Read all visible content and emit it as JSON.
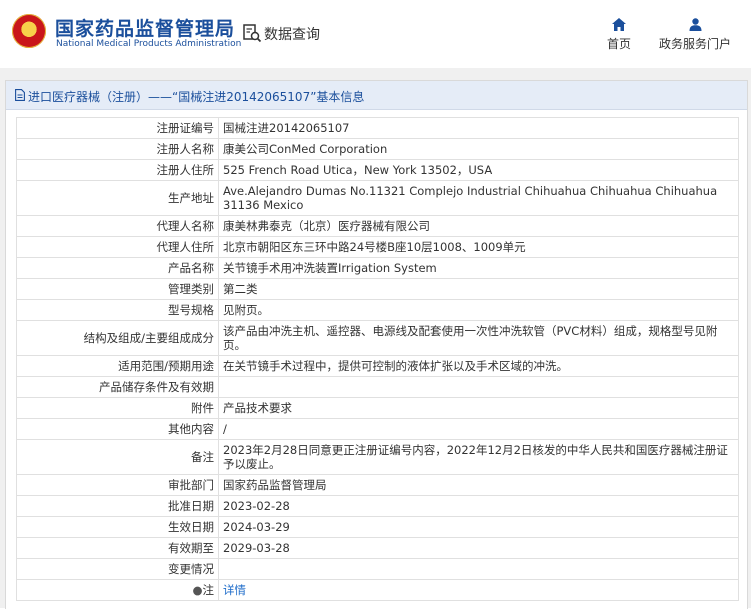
{
  "header": {
    "org_name_cn": "国家药品监督管理局",
    "org_name_en": "National Medical Products Administration",
    "search_label": "数据查询",
    "nav": [
      {
        "label": "首页",
        "icon": "home-icon"
      },
      {
        "label": "政务服务门户",
        "icon": "user-icon"
      }
    ]
  },
  "panel": {
    "title": "进口医疗器械（注册）——“国械注进20142065107”基本信息"
  },
  "records": [
    {
      "label": "注册证编号",
      "value": "国械注进20142065107"
    },
    {
      "label": "注册人名称",
      "value": "康美公司ConMed Corporation"
    },
    {
      "label": "注册人住所",
      "value": "525 French Road Utica，New York 13502，USA"
    },
    {
      "label": "生产地址",
      "value": "Ave.Alejandro Dumas No.11321 Complejo Industrial Chihuahua Chihuahua Chihuahua 31136 Mexico"
    },
    {
      "label": "代理人名称",
      "value": "康美林弗泰克（北京）医疗器械有限公司"
    },
    {
      "label": "代理人住所",
      "value": "北京市朝阳区东三环中路24号楼B座10层1008、1009单元"
    },
    {
      "label": "产品名称",
      "value": "关节镜手术用冲洗装置Irrigation System"
    },
    {
      "label": "管理类别",
      "value": "第二类"
    },
    {
      "label": "型号规格",
      "value": "见附页。"
    },
    {
      "label": "结构及组成/主要组成成分",
      "value": "该产品由冲洗主机、遥控器、电源线及配套使用一次性冲洗软管（PVC材料）组成，规格型号见附页。"
    },
    {
      "label": "适用范围/预期用途",
      "value": "在关节镜手术过程中，提供可控制的液体扩张以及手术区域的冲洗。"
    },
    {
      "label": "产品储存条件及有效期",
      "value": ""
    },
    {
      "label": "附件",
      "value": "产品技术要求"
    },
    {
      "label": "其他内容",
      "value": "/"
    },
    {
      "label": "备注",
      "value": "2023年2月28日同意更正注册证编号内容，2022年12月2日核发的中华人民共和国医疗器械注册证予以废止。"
    },
    {
      "label": "审批部门",
      "value": "国家药品监督管理局"
    },
    {
      "label": "批准日期",
      "value": "2023-02-28"
    },
    {
      "label": "生效日期",
      "value": "2024-03-29"
    },
    {
      "label": "有效期至",
      "value": "2029-03-28"
    },
    {
      "label": "变更情况",
      "value": ""
    },
    {
      "label": "注",
      "value": "详情",
      "icon": "pin-icon"
    }
  ],
  "colors": {
    "brand": "#1b4f9c",
    "title_bar": "#e5ecf7",
    "link": "#1b6ac9",
    "emblem_red": "#c9161b"
  }
}
